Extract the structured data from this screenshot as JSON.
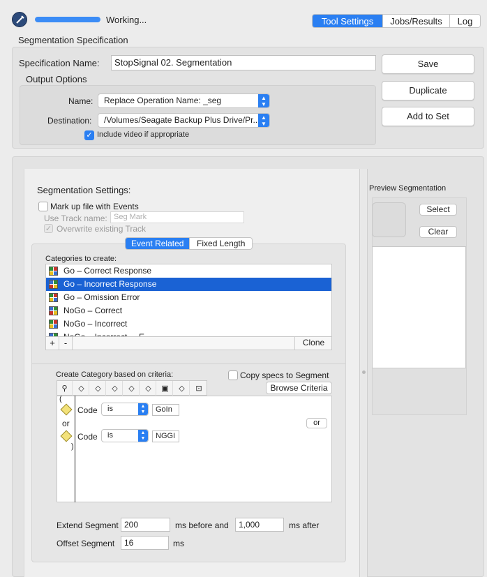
{
  "toolbar": {
    "status": "Working...",
    "progress": 1.0,
    "tabs": [
      "Tool Settings",
      "Jobs/Results",
      "Log"
    ],
    "active_tab": "Tool Settings"
  },
  "spec": {
    "section_title": "Segmentation Specification",
    "name_label": "Specification Name:",
    "name_value": "StopSignal 02. Segmentation",
    "output_title": "Output Options",
    "output_name_label": "Name:",
    "output_name_value": "Replace Operation Name: _seg",
    "destination_label": "Destination:",
    "destination_value": "/Volumes/Seagate Backup Plus Drive/Pr...",
    "include_video_label": "Include video if appropriate",
    "include_video_checked": true,
    "save_label": "Save",
    "duplicate_label": "Duplicate",
    "add_to_set_label": "Add to Set"
  },
  "settings": {
    "title": "Segmentation Settings:",
    "markup_label": "Mark up file with Events",
    "use_track_label": "Use Track name:",
    "track_placeholder": "Seg Mark",
    "overwrite_label": "Overwrite existing Track",
    "mode_tabs": [
      "Event Related",
      "Fixed Length"
    ],
    "active_mode": "Event Related",
    "categories_label": "Categories to create:",
    "categories": [
      {
        "label": "Go – Correct Response",
        "selected": false
      },
      {
        "label": "Go – Incorrect Response",
        "selected": true
      },
      {
        "label": "Go – Omission Error",
        "selected": false
      },
      {
        "label": "NoGo – Correct",
        "selected": false
      },
      {
        "label": "NoGo – Incorrect",
        "selected": false
      },
      {
        "label": "NoGo – Incorrect ... E...",
        "selected": false
      }
    ],
    "add_label": "+",
    "remove_label": "-",
    "clone_label": "Clone",
    "criteria_label": "Create Category based on criteria:",
    "copy_specs_label": "Copy specs to Segment",
    "browse_label": "Browse Criteria",
    "open_paren": "(",
    "close_paren": ")",
    "or_text": "or",
    "or_button": "or",
    "criteria": [
      {
        "field": "Code",
        "op": "is",
        "value": "GoIn"
      },
      {
        "field": "Code",
        "op": "is",
        "value": "NGGI"
      }
    ],
    "extend_label": "Extend Segment",
    "extend_before": "200",
    "before_label": "ms before and",
    "extend_after": "1,000",
    "after_label": "ms after",
    "offset_label": "Offset Segment",
    "offset_value": "16",
    "ms_label": "ms"
  },
  "preview": {
    "title": "Preview Segmentation",
    "select_label": "Select",
    "clear_label": "Clear"
  },
  "colors": {
    "accent": "#2a7ff2",
    "selection": "#1a62d4"
  }
}
